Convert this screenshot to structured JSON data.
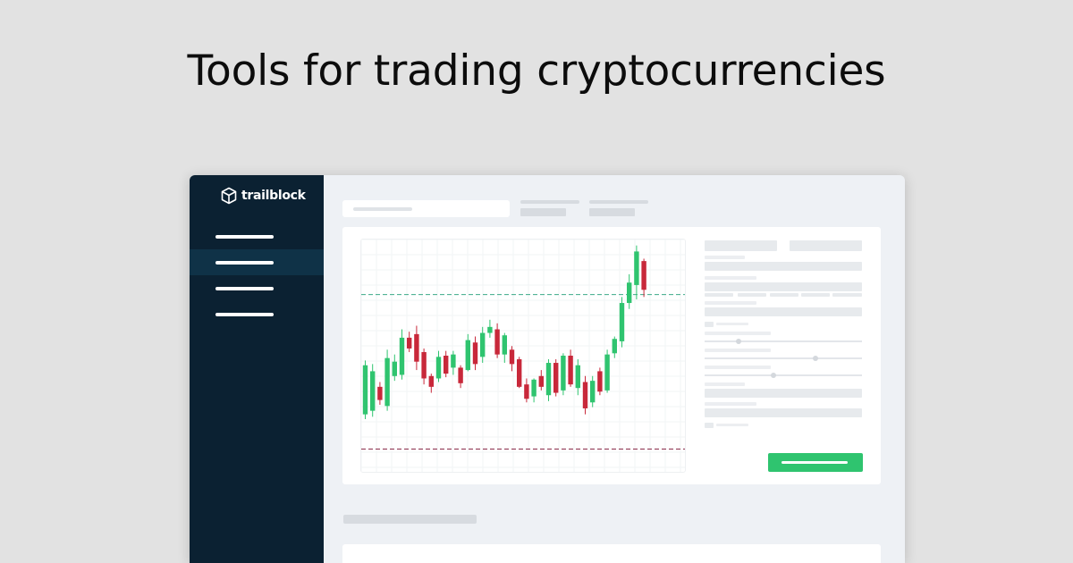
{
  "headline": "Tools for trading cryptocurrencies",
  "app": {
    "logo_text": "trailblock",
    "logo_icon": "cube-outline-icon",
    "sidebar_active_index": 1,
    "colors": {
      "sidebar": "#0b2132",
      "sidebar_active": "#0f3247",
      "up": "#2fc46f",
      "down": "#c8283a",
      "resistance": "#3daa88",
      "support": "#8a2c4a",
      "action_button": "#2fc46f"
    }
  },
  "chart_data": {
    "type": "candlestick",
    "grid": true,
    "reference_lines": [
      "resistance (dashed, green)",
      "support (dashed, red)"
    ],
    "candles": [
      {
        "o": 142,
        "c": 183,
        "h": 187,
        "l": 138
      },
      {
        "o": 145,
        "c": 178,
        "h": 184,
        "l": 140
      },
      {
        "o": 165,
        "c": 154,
        "h": 169,
        "l": 150
      },
      {
        "o": 149,
        "c": 189,
        "h": 196,
        "l": 145
      },
      {
        "o": 174,
        "c": 186,
        "h": 192,
        "l": 170
      },
      {
        "o": 175,
        "c": 206,
        "h": 213,
        "l": 171
      },
      {
        "o": 206,
        "c": 197,
        "h": 211,
        "l": 194
      },
      {
        "o": 209,
        "c": 186,
        "h": 216,
        "l": 179
      },
      {
        "o": 194,
        "c": 172,
        "h": 197,
        "l": 167
      },
      {
        "o": 174,
        "c": 165,
        "h": 176,
        "l": 160
      },
      {
        "o": 172,
        "c": 190,
        "h": 195,
        "l": 169
      },
      {
        "o": 191,
        "c": 176,
        "h": 195,
        "l": 173
      },
      {
        "o": 181,
        "c": 192,
        "h": 195,
        "l": 175
      },
      {
        "o": 181,
        "c": 168,
        "h": 183,
        "l": 164
      },
      {
        "o": 179,
        "c": 204,
        "h": 209,
        "l": 178
      },
      {
        "o": 202,
        "c": 184,
        "h": 207,
        "l": 179
      },
      {
        "o": 190,
        "c": 210,
        "h": 215,
        "l": 185
      },
      {
        "o": 210,
        "c": 215,
        "h": 221,
        "l": 206
      },
      {
        "o": 213,
        "c": 192,
        "h": 218,
        "l": 189
      },
      {
        "o": 192,
        "c": 208,
        "h": 210,
        "l": 185
      },
      {
        "o": 196,
        "c": 184,
        "h": 199,
        "l": 178
      },
      {
        "o": 188,
        "c": 165,
        "h": 190,
        "l": 164
      },
      {
        "o": 167,
        "c": 155,
        "h": 172,
        "l": 152
      },
      {
        "o": 157,
        "c": 171,
        "h": 172,
        "l": 152
      },
      {
        "o": 174,
        "c": 165,
        "h": 179,
        "l": 162
      },
      {
        "o": 158,
        "c": 185,
        "h": 188,
        "l": 153
      },
      {
        "o": 185,
        "c": 160,
        "h": 188,
        "l": 157
      },
      {
        "o": 162,
        "c": 191,
        "h": 193,
        "l": 158
      },
      {
        "o": 191,
        "c": 167,
        "h": 196,
        "l": 165
      },
      {
        "o": 164,
        "c": 183,
        "h": 188,
        "l": 158
      },
      {
        "o": 169,
        "c": 147,
        "h": 174,
        "l": 142
      },
      {
        "o": 152,
        "c": 170,
        "h": 174,
        "l": 148
      },
      {
        "o": 178,
        "c": 161,
        "h": 181,
        "l": 158
      },
      {
        "o": 162,
        "c": 192,
        "h": 196,
        "l": 160
      },
      {
        "o": 193,
        "c": 205,
        "h": 207,
        "l": 189
      },
      {
        "o": 203,
        "c": 235,
        "h": 240,
        "l": 198
      },
      {
        "o": 235,
        "c": 252,
        "h": 259,
        "l": 230
      },
      {
        "o": 250,
        "c": 278,
        "h": 283,
        "l": 238
      },
      {
        "o": 270,
        "c": 246,
        "h": 272,
        "l": 240
      }
    ],
    "resistance": 242,
    "support": 113,
    "ylim": [
      94,
      288
    ]
  }
}
